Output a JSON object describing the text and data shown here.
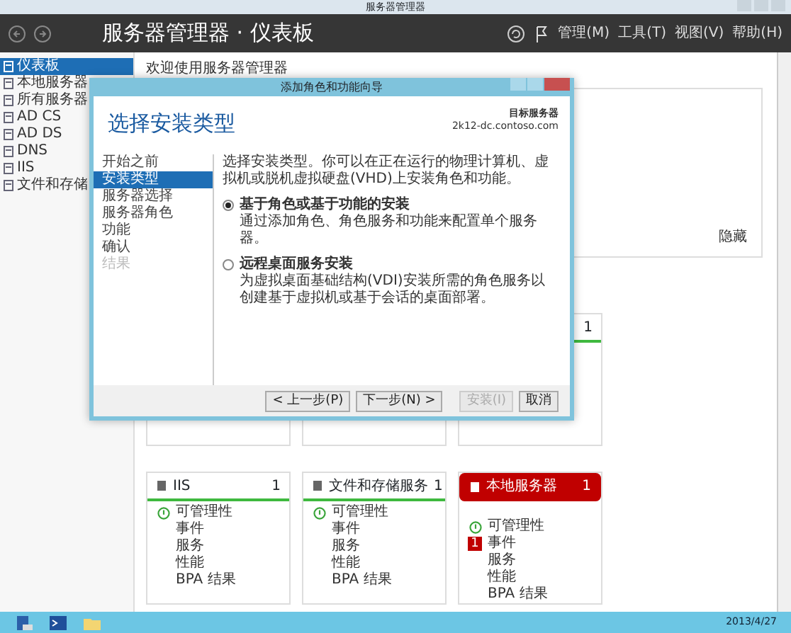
{
  "window": {
    "title": "服务器管理器"
  },
  "header": {
    "title": "服务器管理器 · 仪表板",
    "menus": [
      "管理(M)",
      "工具(T)",
      "视图(V)",
      "帮助(H)"
    ]
  },
  "sidebar": {
    "items": [
      {
        "label": "仪表板",
        "selected": true
      },
      {
        "label": "本地服务器",
        "selected": false
      },
      {
        "label": "所有服务器",
        "selected": false
      },
      {
        "label": "AD CS",
        "selected": false
      },
      {
        "label": "AD DS",
        "selected": false
      },
      {
        "label": "DNS",
        "selected": false
      },
      {
        "label": "IIS",
        "selected": false
      },
      {
        "label": "文件和存储",
        "selected": false
      }
    ]
  },
  "welcome": {
    "title": "欢迎使用服务器管理器",
    "hide": "隐藏"
  },
  "upper_tiles": [
    {
      "alert": false,
      "count": "1"
    }
  ],
  "tiles": [
    {
      "title": "IIS",
      "count": "1",
      "alert": false,
      "items": [
        {
          "label": "可管理性",
          "kind": "ok"
        },
        {
          "label": "事件",
          "kind": "plain"
        },
        {
          "label": "服务",
          "kind": "plain"
        },
        {
          "label": "性能",
          "kind": "plain"
        },
        {
          "label": "BPA 结果",
          "kind": "plain"
        }
      ]
    },
    {
      "title": "文件和存储服务",
      "count": "1",
      "alert": false,
      "items": [
        {
          "label": "可管理性",
          "kind": "ok"
        },
        {
          "label": "事件",
          "kind": "plain"
        },
        {
          "label": "服务",
          "kind": "plain"
        },
        {
          "label": "性能",
          "kind": "plain"
        },
        {
          "label": "BPA 结果",
          "kind": "plain"
        }
      ]
    },
    {
      "title": "本地服务器",
      "count": "1",
      "alert": true,
      "items": [
        {
          "label": "可管理性",
          "kind": "ok"
        },
        {
          "label": "事件",
          "kind": "alert",
          "badge": "1"
        },
        {
          "label": "服务",
          "kind": "plain"
        },
        {
          "label": "性能",
          "kind": "plain"
        },
        {
          "label": "BPA 结果",
          "kind": "plain"
        }
      ]
    }
  ],
  "wizard": {
    "title": "添加角色和功能向导",
    "heading": "选择安装类型",
    "target_label": "目标服务器",
    "target": "2k12-dc.contoso.com",
    "steps": [
      {
        "label": "开始之前",
        "selected": false,
        "disabled": false
      },
      {
        "label": "安装类型",
        "selected": true,
        "disabled": false
      },
      {
        "label": "服务器选择",
        "selected": false,
        "disabled": false
      },
      {
        "label": "服务器角色",
        "selected": false,
        "disabled": false
      },
      {
        "label": "功能",
        "selected": false,
        "disabled": false
      },
      {
        "label": "确认",
        "selected": false,
        "disabled": false
      },
      {
        "label": "结果",
        "selected": false,
        "disabled": true
      }
    ],
    "intro": "选择安装类型。你可以在正在运行的物理计算机、虚拟机或脱机虚拟硬盘(VHD)上安装角色和功能。",
    "options": [
      {
        "label": "基于角色或基于功能的安装",
        "description": "通过添加角色、角色服务和功能来配置单个服务器。",
        "selected": true
      },
      {
        "label": "远程桌面服务安装",
        "description": "为虚拟桌面基础结构(VDI)安装所需的角色服务以创建基于虚拟机或基于会话的桌面部署。",
        "selected": false
      }
    ],
    "buttons": [
      {
        "label": "< 上一步(P)",
        "disabled": false
      },
      {
        "label": "下一步(N) >",
        "disabled": false
      },
      {
        "label": "安装(I)",
        "disabled": true
      },
      {
        "label": "取消",
        "disabled": false
      }
    ]
  },
  "taskbar": {
    "clock": "2013/4/27"
  }
}
